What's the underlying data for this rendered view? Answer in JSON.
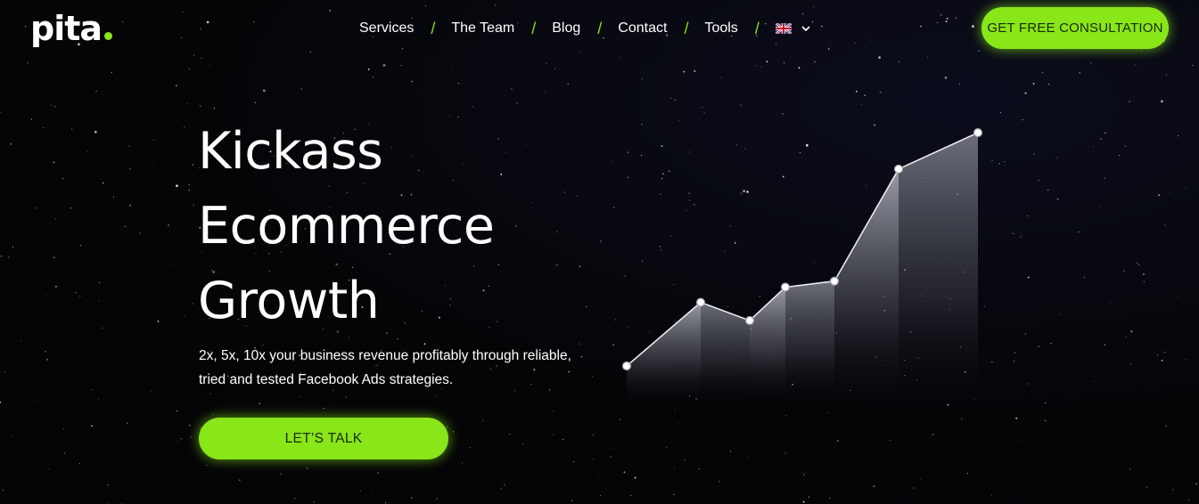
{
  "header": {
    "logo_text": "pita",
    "nav": [
      {
        "label": "Services"
      },
      {
        "label": "The Team"
      },
      {
        "label": "Blog"
      },
      {
        "label": "Contact"
      },
      {
        "label": "Tools"
      }
    ],
    "language_icon": "uk-flag-icon",
    "cta_label": "GET FREE CONSULTATION"
  },
  "hero": {
    "headline": [
      "Kickass",
      "Ecommerce",
      "Growth"
    ],
    "subtext": "2x, 5x, 10x your business revenue profitably through reliable, tried and tested Facebook Ads strategies.",
    "cta_label": "LET’S TALK"
  },
  "colors": {
    "accent": "#88e619",
    "background": "#050508",
    "text": "#ffffff"
  },
  "decorative_chart": {
    "type": "line",
    "description_visible": false,
    "values": [
      1,
      3.1,
      2.5,
      3.6,
      3.8,
      7.5,
      8.7
    ]
  }
}
